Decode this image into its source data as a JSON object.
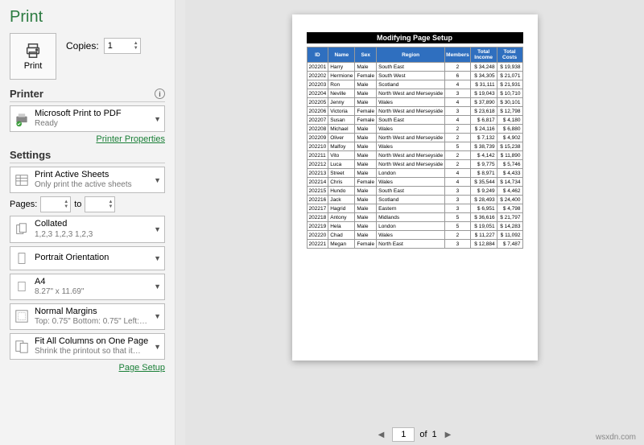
{
  "title": "Print",
  "print_button": "Print",
  "copies": {
    "label": "Copies:",
    "value": "1"
  },
  "printer": {
    "heading": "Printer",
    "name": "Microsoft Print to PDF",
    "status": "Ready",
    "properties_link": "Printer Properties"
  },
  "settings": {
    "heading": "Settings",
    "scope": {
      "title": "Print Active Sheets",
      "sub": "Only print the active sheets"
    },
    "pages": {
      "label": "Pages:",
      "to": "to"
    },
    "collate": {
      "title": "Collated",
      "sub": "1,2,3   1,2,3   1,2,3"
    },
    "orientation": {
      "title": "Portrait Orientation"
    },
    "paper": {
      "title": "A4",
      "sub": "8.27\" x 11.69\""
    },
    "margins": {
      "title": "Normal Margins",
      "sub": "Top: 0.75\" Bottom: 0.75\" Left:…"
    },
    "scaling": {
      "title": "Fit All Columns on One Page",
      "sub": "Shrink the printout so that it…"
    },
    "page_setup_link": "Page Setup"
  },
  "pager": {
    "current": "1",
    "of_label": "of",
    "total": "1"
  },
  "sheet": {
    "title": "Modifying Page Setup",
    "headers": [
      "ID",
      "Name",
      "Sex",
      "Region",
      "Members",
      "Total Income",
      "Total Costs"
    ],
    "rows": [
      [
        "202201",
        "Harry",
        "Male",
        "South East",
        "2",
        "$ 34,248",
        "$ 19,938"
      ],
      [
        "202202",
        "Hermione",
        "Female",
        "South West",
        "6",
        "$ 34,305",
        "$ 21,071"
      ],
      [
        "202203",
        "Ron",
        "Male",
        "Scotland",
        "4",
        "$ 31,111",
        "$ 21,931"
      ],
      [
        "202204",
        "Neville",
        "Male",
        "North West and Merseyside",
        "3",
        "$ 19,043",
        "$ 10,710"
      ],
      [
        "202205",
        "Jenny",
        "Male",
        "Wales",
        "4",
        "$ 37,890",
        "$ 30,101"
      ],
      [
        "202206",
        "Victoria",
        "Female",
        "North West and Merseyside",
        "3",
        "$ 23,618",
        "$ 12,798"
      ],
      [
        "202207",
        "Susan",
        "Female",
        "South East",
        "4",
        "$ 6,817",
        "$ 4,180"
      ],
      [
        "202208",
        "Michael",
        "Male",
        "Wales",
        "2",
        "$ 24,116",
        "$ 6,880"
      ],
      [
        "202209",
        "Oliver",
        "Male",
        "North West and Merseyside",
        "2",
        "$ 7,132",
        "$ 4,902"
      ],
      [
        "202210",
        "Malfoy",
        "Male",
        "Wales",
        "5",
        "$ 38,739",
        "$ 15,238"
      ],
      [
        "202211",
        "Vito",
        "Male",
        "North West and Merseyside",
        "2",
        "$ 4,142",
        "$ 11,890"
      ],
      [
        "202212",
        "Luca",
        "Male",
        "North West and Merseyside",
        "2",
        "$ 9,775",
        "$ 5,746"
      ],
      [
        "202213",
        "Street",
        "Male",
        "London",
        "4",
        "$ 8,971",
        "$ 4,433"
      ],
      [
        "202214",
        "Chris",
        "Female",
        "Wales",
        "4",
        "$ 35,544",
        "$ 14,734"
      ],
      [
        "202215",
        "Hundo",
        "Male",
        "South East",
        "3",
        "$ 9,249",
        "$ 4,462"
      ],
      [
        "202216",
        "Jack",
        "Male",
        "Scotland",
        "3",
        "$ 28,493",
        "$ 24,400"
      ],
      [
        "202217",
        "Hagrid",
        "Male",
        "Eastern",
        "3",
        "$ 6,951",
        "$ 4,798"
      ],
      [
        "202218",
        "Antony",
        "Male",
        "Midlands",
        "5",
        "$ 36,616",
        "$ 21,797"
      ],
      [
        "202219",
        "Hela",
        "Male",
        "London",
        "5",
        "$ 19,051",
        "$ 14,283"
      ],
      [
        "202220",
        "Chad",
        "Male",
        "Wales",
        "2",
        "$ 11,227",
        "$ 11,092"
      ],
      [
        "202221",
        "Megan",
        "Female",
        "North East",
        "3",
        "$ 12,884",
        "$ 7,487"
      ]
    ]
  },
  "watermark": "wsxdn.com"
}
